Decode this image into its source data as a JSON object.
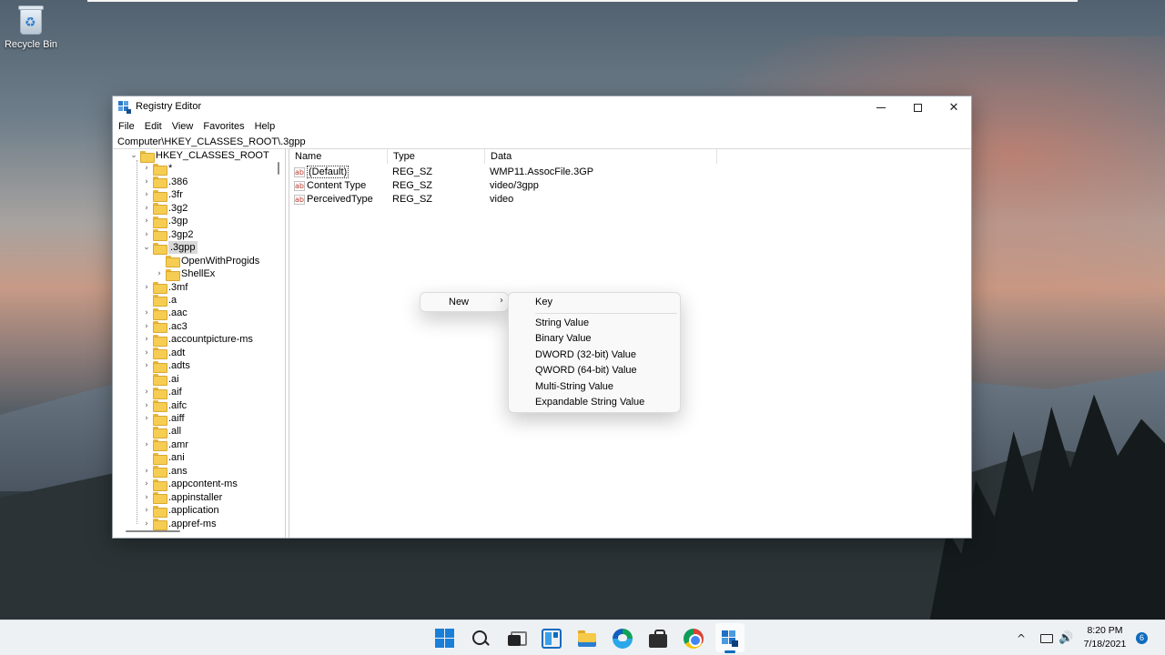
{
  "desktop": {
    "recycle_bin_label": "Recycle Bin"
  },
  "window": {
    "title": "Registry Editor",
    "menu": [
      "File",
      "Edit",
      "View",
      "Favorites",
      "Help"
    ],
    "address": "Computer\\HKEY_CLASSES_ROOT\\.3gpp"
  },
  "tree": {
    "root": "HKEY_CLASSES_ROOT",
    "items": [
      [
        "*",
        ".386",
        ".3fr",
        ".3g2",
        ".3gp",
        ".3gp2"
      ],
      ".3gpp",
      [
        "OpenWithProgids",
        "ShellEx"
      ],
      [
        ".3mf",
        ".a",
        ".aac",
        ".ac3",
        ".accountpicture-ms",
        ".adt",
        ".adts",
        ".ai",
        ".aif",
        ".aifc",
        ".aiff",
        ".all",
        ".amr",
        ".ani",
        ".ans",
        ".appcontent-ms",
        ".appinstaller",
        ".application",
        ".appref-ms"
      ]
    ]
  },
  "list": {
    "columns": [
      "Name",
      "Type",
      "Data"
    ],
    "rows": [
      {
        "name": "(Default)",
        "type": "REG_SZ",
        "data": "WMP11.AssocFile.3GP"
      },
      {
        "name": "Content Type",
        "type": "REG_SZ",
        "data": "video/3gpp"
      },
      {
        "name": "PerceivedType",
        "type": "REG_SZ",
        "data": "video"
      }
    ]
  },
  "context_menu": {
    "new_label": "New",
    "submenu": [
      "Key",
      "String Value",
      "Binary Value",
      "DWORD (32-bit) Value",
      "QWORD (64-bit) Value",
      "Multi-String Value",
      "Expandable String Value"
    ]
  },
  "taskbar": {
    "time": "8:20 PM",
    "date": "7/18/2021",
    "notification_count": "6"
  },
  "icons": {
    "app": "registry-editor-icon",
    "taskbar": [
      "start-icon",
      "search-icon",
      "task-view-icon",
      "widgets-icon",
      "file-explorer-icon",
      "edge-icon",
      "store-icon",
      "chrome-icon",
      "registry-editor-icon"
    ]
  }
}
